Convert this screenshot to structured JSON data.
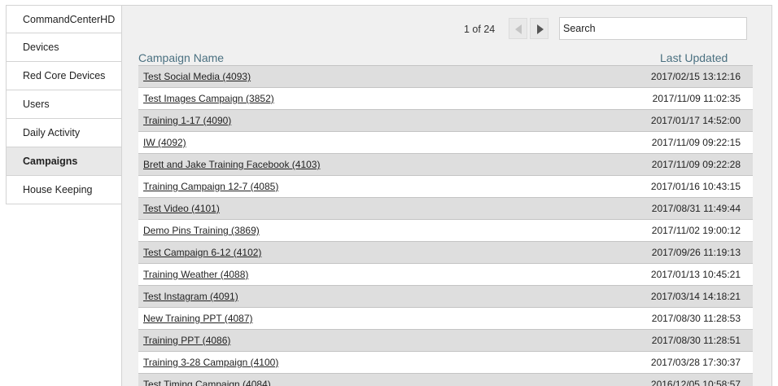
{
  "sidebar": {
    "items": [
      {
        "label": "CommandCenterHD",
        "active": false
      },
      {
        "label": "Devices",
        "active": false
      },
      {
        "label": "Red Core Devices",
        "active": false
      },
      {
        "label": "Users",
        "active": false
      },
      {
        "label": "Daily Activity",
        "active": false
      },
      {
        "label": "Campaigns",
        "active": true
      },
      {
        "label": "House Keeping",
        "active": false
      }
    ]
  },
  "pager": {
    "text": "1 of 24"
  },
  "search": {
    "placeholder": "Search",
    "value": ""
  },
  "table": {
    "headers": {
      "name": "Campaign Name",
      "updated": "Last Updated"
    },
    "rows": [
      {
        "name": "Test Social Media (4093)",
        "updated": "2017/02/15 13:12:16"
      },
      {
        "name": "Test Images Campaign (3852)",
        "updated": "2017/11/09 11:02:35"
      },
      {
        "name": "Training 1-17 (4090)",
        "updated": "2017/01/17 14:52:00"
      },
      {
        "name": "IW (4092)",
        "updated": "2017/11/09 09:22:15"
      },
      {
        "name": "Brett and Jake Training Facebook (4103)",
        "updated": "2017/11/09 09:22:28"
      },
      {
        "name": "Training Campaign 12-7 (4085)",
        "updated": "2017/01/16 10:43:15"
      },
      {
        "name": "Test Video (4101)",
        "updated": "2017/08/31 11:49:44"
      },
      {
        "name": "Demo Pins Training (3869)",
        "updated": "2017/11/02 19:00:12"
      },
      {
        "name": "Test Campaign 6-12 (4102)",
        "updated": "2017/09/26 11:19:13"
      },
      {
        "name": "Training Weather (4088)",
        "updated": "2017/01/13 10:45:21"
      },
      {
        "name": "Test Instagram (4091)",
        "updated": "2017/03/14 14:18:21"
      },
      {
        "name": "New Training PPT (4087)",
        "updated": "2017/08/30 11:28:53"
      },
      {
        "name": "Training PPT (4086)",
        "updated": "2017/08/30 11:28:51"
      },
      {
        "name": "Training 3-28 Campaign (4100)",
        "updated": "2017/03/28 17:30:37"
      },
      {
        "name": "Test Timing Campaign (4084)",
        "updated": "2016/12/05 10:58:57"
      }
    ]
  }
}
